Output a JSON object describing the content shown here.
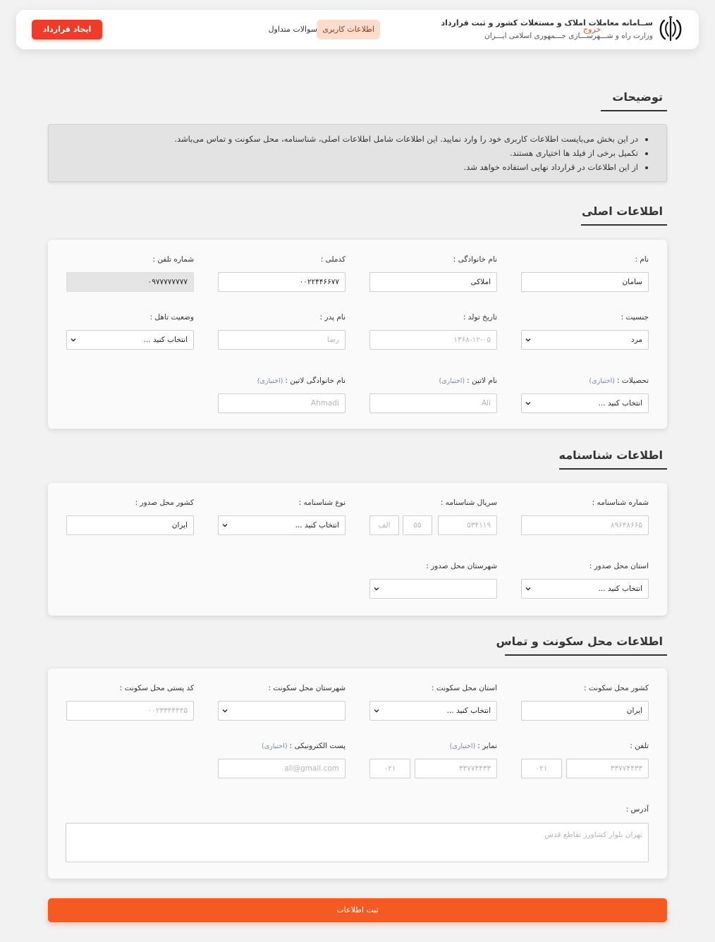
{
  "header": {
    "title": "ســامانه معاملات املاک و مستغلات کشور و ثبت قرارداد",
    "subtitle": "وزارت راه و شـــهرســـازی جـــمهوری اسلامی ایـــران",
    "nav": {
      "profile": "اطلاعات کاربری",
      "faq": "سوالات متداول"
    },
    "logout": "خروج",
    "create_contract": "ایجاد قرارداد",
    "logo_icon": "iran-emblem-icon"
  },
  "description": {
    "title": "توضیحات",
    "items": [
      "در این بخش می‌بایست اطلاعات کاربری خود را وارد نمایید. این اطلاعات شامل اطلاعات اصلی، شناسنامه، محل سکونت و تماس می‌باشد.",
      "تکمیل برخی از فیلد ها اختیاری هستند.",
      "از این اطلاعات در قرارداد نهایی استفاده خواهد شد."
    ]
  },
  "optional_tag": "(اختیاری)",
  "main_info": {
    "title": "اطلاعات اصلی",
    "first_name": {
      "label": "نام :",
      "value": "سامان"
    },
    "last_name": {
      "label": "نام خانوادگی :",
      "value": "املاکی"
    },
    "national_code": {
      "label": "کدملی :",
      "value": "۰۰۲۲۴۴۶۶۷۷"
    },
    "phone": {
      "label": "شماره تلفن :",
      "value": "۰۹۷۷۷۷۷۷۷۷"
    },
    "gender": {
      "label": "جنسیت :",
      "value": "مرد"
    },
    "birth_date": {
      "label": "تاریخ تولد :",
      "placeholder": "۱۳۶۸-۱۲-۰۵"
    },
    "father_name": {
      "label": "نام پدر :",
      "placeholder": "رضا"
    },
    "marital": {
      "label": "وضعیت تاهل :",
      "value": "انتخاب کنید ..."
    },
    "education": {
      "label": "تحصیلات :",
      "value": "انتخاب کنید ..."
    },
    "latin_name": {
      "label": "نام لاتین :",
      "placeholder": "Ali"
    },
    "latin_last_name": {
      "label": "نام خانوادگی لاتین :",
      "placeholder": "Ahmadi"
    }
  },
  "id_info": {
    "title": "اطلاعات شناسنامه",
    "id_number": {
      "label": "شماره شناسنامه :",
      "placeholder": "۸۹۶۴۸۶۶۵"
    },
    "serial": {
      "label": "سریال شناسنامه :",
      "number_placeholder": "۵۳۴۱۱۹",
      "part2_placeholder": "۵۵",
      "letter_placeholder": "الف"
    },
    "id_type": {
      "label": "نوع شناسنامه :",
      "value": "انتخاب کنید ..."
    },
    "issue_country": {
      "label": "کشور محل صدور :",
      "value": "ایران"
    },
    "issue_province": {
      "label": "استان محل صدور :",
      "value": "انتخاب کنید ..."
    },
    "issue_city": {
      "label": "شهرستان محل صدور :",
      "value": ""
    }
  },
  "residence": {
    "title": "اطلاعات محل سکونت و تماس",
    "country": {
      "label": "کشور محل سکونت :",
      "value": "ایران"
    },
    "province": {
      "label": "استان محل سکونت :",
      "value": "انتخاب کنید ..."
    },
    "city": {
      "label": "شهرستان محل سکونت :",
      "value": ""
    },
    "postal_code": {
      "label": "کد پستی محل سکونت :",
      "placeholder": "۰۰۲۳۳۴۴۴۴۵"
    },
    "tel": {
      "label": "تلفن :",
      "number_placeholder": "۳۳۷۷۴۴۳۳",
      "code_placeholder": "۰۲۱"
    },
    "fax": {
      "label": "نمابر :",
      "number_placeholder": "۳۳۷۷۴۴۳۳",
      "code_placeholder": "۰۲۱"
    },
    "email": {
      "label": "پست الکترونیکی :",
      "placeholder": "ali@gmail.com"
    },
    "address": {
      "label": "آدرس :",
      "placeholder": "تهران بلوار کشاورز تقاطع قدس"
    }
  },
  "submit_label": "ثبت اطلاعات"
}
